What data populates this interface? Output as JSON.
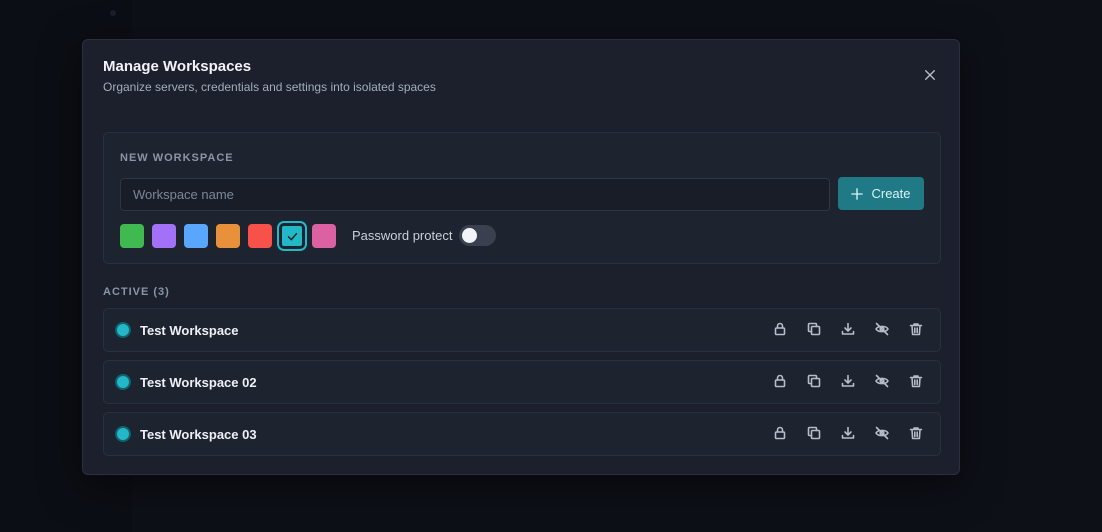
{
  "modal": {
    "title": "Manage Workspaces",
    "subtitle": "Organize servers, credentials and settings into isolated spaces",
    "close_icon": "close-icon"
  },
  "new_workspace": {
    "section_label": "NEW WORKSPACE",
    "name_placeholder": "Workspace name",
    "name_value": "",
    "create_label": "Create",
    "create_icon": "plus-icon",
    "colors": [
      {
        "name": "green",
        "hex": "#3fb950",
        "selected": false
      },
      {
        "name": "purple",
        "hex": "#a371f7",
        "selected": false
      },
      {
        "name": "blue",
        "hex": "#58a6ff",
        "selected": false
      },
      {
        "name": "orange",
        "hex": "#e8913a",
        "selected": false
      },
      {
        "name": "red",
        "hex": "#f85149",
        "selected": false
      },
      {
        "name": "teal",
        "hex": "#22b8c7",
        "selected": true
      },
      {
        "name": "pink",
        "hex": "#db61a2",
        "selected": false
      }
    ],
    "password_protect_label": "Password protect",
    "password_protect_on": false
  },
  "active": {
    "section_label": "ACTIVE (3)",
    "workspaces": [
      {
        "name": "Test Workspace",
        "color": "#22b8c7"
      },
      {
        "name": "Test Workspace 02",
        "color": "#22b8c7"
      },
      {
        "name": "Test Workspace 03",
        "color": "#22b8c7"
      }
    ],
    "actions": [
      "lock-icon",
      "duplicate-icon",
      "download-icon",
      "eye-off-icon",
      "trash-icon"
    ]
  }
}
